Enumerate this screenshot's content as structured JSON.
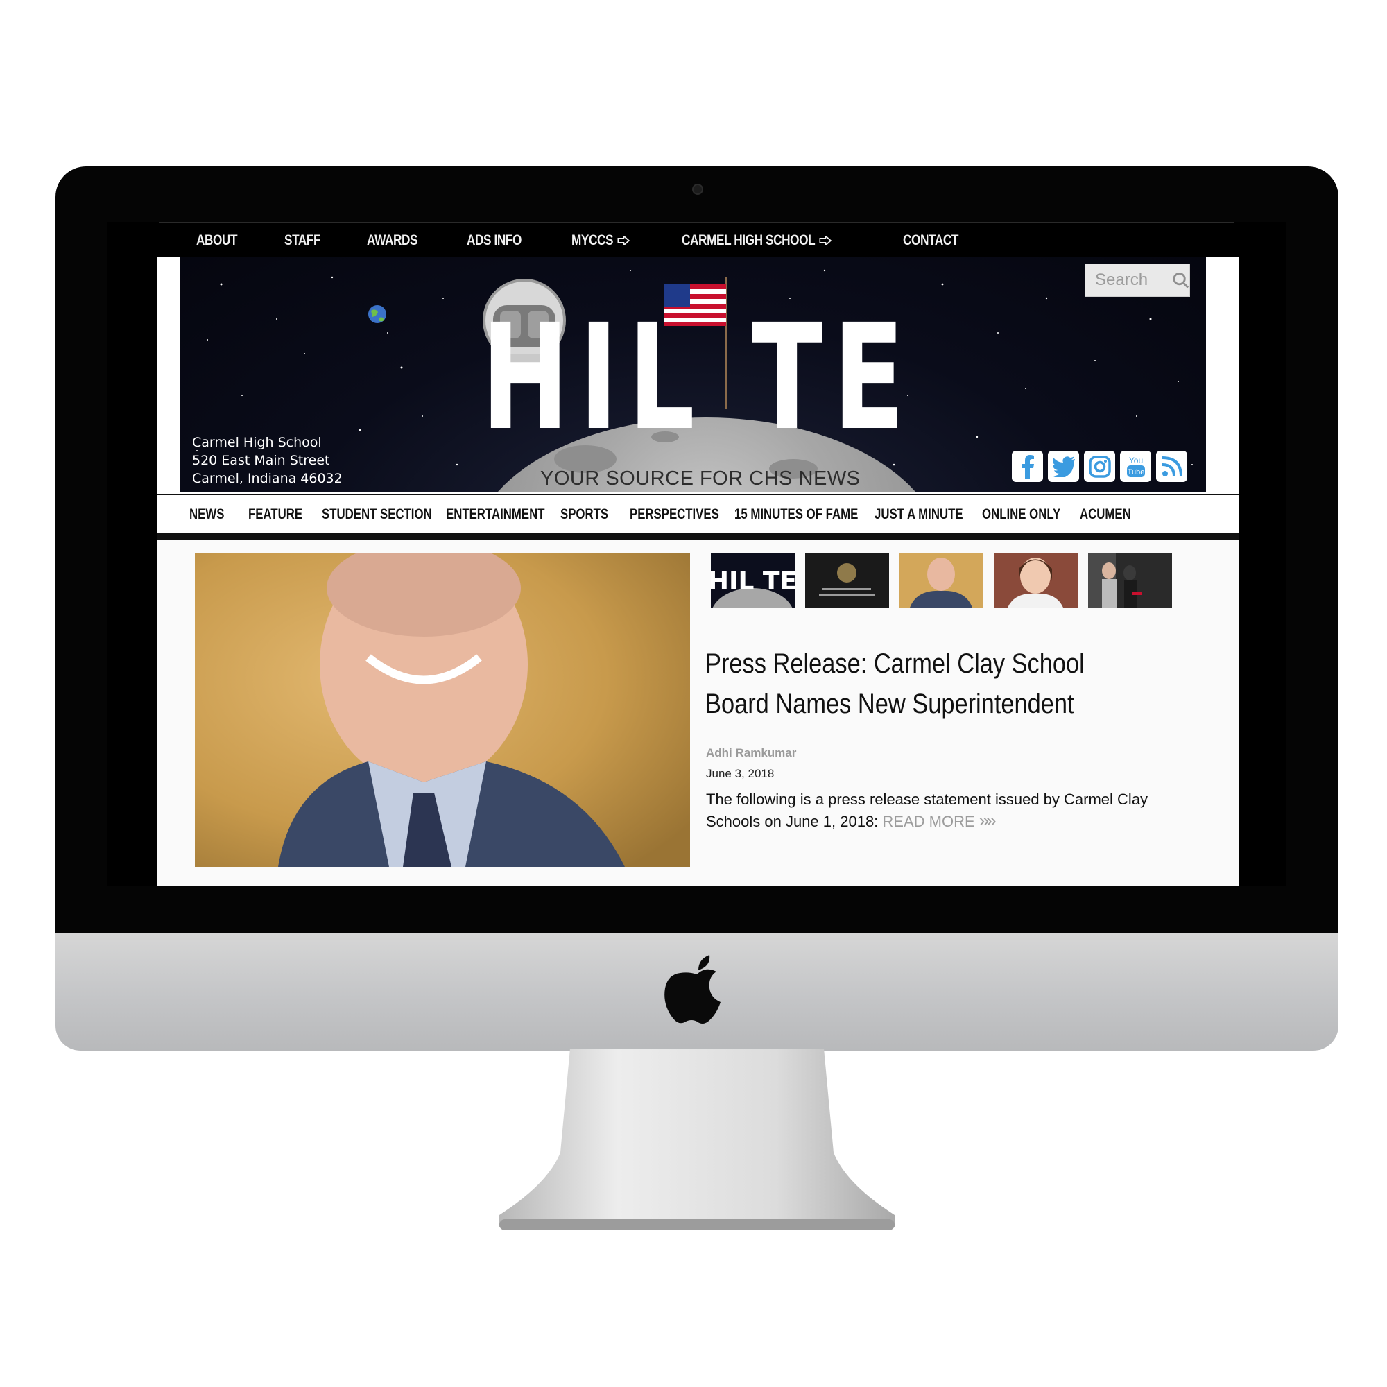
{
  "top_nav": {
    "items": [
      "About",
      "Staff",
      "Awards",
      "Ads Info",
      "MyCCS",
      "Carmel High School",
      "Contact"
    ]
  },
  "banner": {
    "logo_text": "HIL TE",
    "tagline": "Your source for CHS News",
    "address_line1": "Carmel High School",
    "address_line2": "520 East Main Street",
    "address_line3": "Carmel, Indiana 46032",
    "search_placeholder": "Search",
    "social_icons": [
      "facebook-icon",
      "twitter-icon",
      "instagram-icon",
      "youtube-icon",
      "rss-icon"
    ]
  },
  "section_nav": {
    "items": [
      "News",
      "Feature",
      "Student Section",
      "Entertainment",
      "Sports",
      "Perspectives",
      "15 Minutes of Fame",
      "Just a Minute",
      "Online Only",
      "Acumen"
    ]
  },
  "featured": {
    "headline": "Press Release: Carmel Clay School Board Names New Superintendent",
    "author": "Adhi Ramkumar",
    "date": "June 3, 2018",
    "excerpt": "The following is a press release statement issued by Carmel Clay Schools on June 1, 2018:",
    "read_more": "READ MORE",
    "thumbnail_count": 5
  },
  "colors": {
    "banner_bg": "#0a0c1a",
    "social_blue": "#3b9be0",
    "nav_text": "#111111"
  }
}
